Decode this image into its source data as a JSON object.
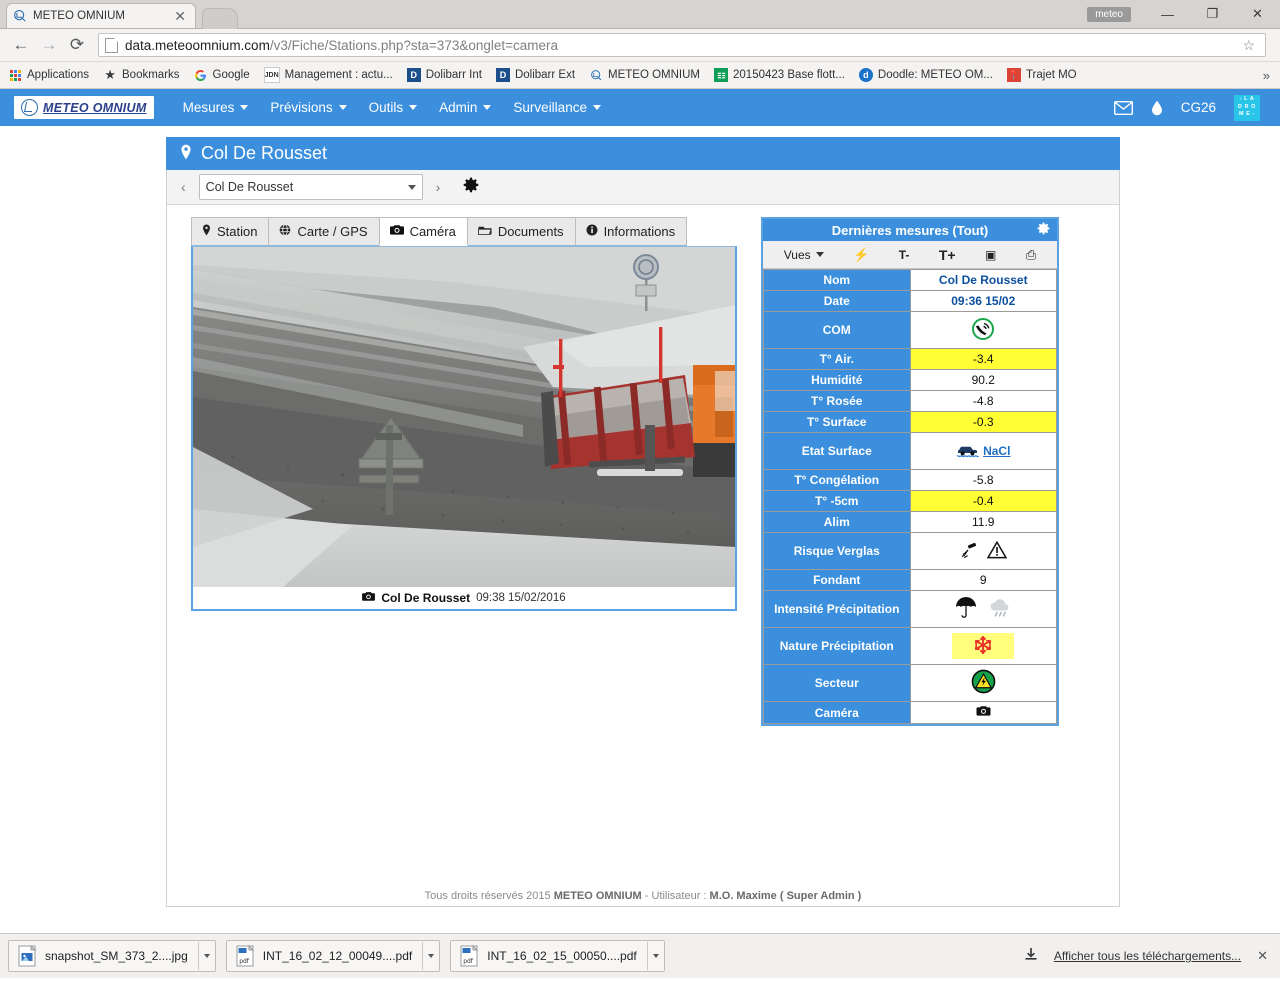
{
  "browser": {
    "tab_title": "METEO OMNIUM",
    "tab_close": "✕",
    "url_main": "data.meteoomnium.com",
    "url_rest": "/v3/Fiche/Stations.php?sta=373&onglet=camera",
    "back_icon": "←",
    "forward_icon": "→",
    "reload_icon": "⟳",
    "star_icon": "☆",
    "window_title_pill": "meteo",
    "minimize": "—",
    "maximize": "❐",
    "close": "✕",
    "bookmarks": [
      {
        "label": "Applications",
        "icon": "apps-grid-icon"
      },
      {
        "label": "Bookmarks",
        "icon": "star-icon"
      },
      {
        "label": "Google",
        "icon": "google-icon"
      },
      {
        "label": "Management : actu...",
        "icon": "jdn-icon"
      },
      {
        "label": "Dolibarr Int",
        "icon": "dolibarr-icon"
      },
      {
        "label": "Dolibarr Ext",
        "icon": "dolibarr-icon"
      },
      {
        "label": "METEO OMNIUM",
        "icon": "meteo-icon"
      },
      {
        "label": "20150423 Base flott...",
        "icon": "sheets-icon"
      },
      {
        "label": "Doodle: METEO OM...",
        "icon": "doodle-icon"
      },
      {
        "label": "Trajet MO",
        "icon": "maps-pin-icon"
      }
    ],
    "bookmarks_overflow": "»"
  },
  "appbar": {
    "brand": "METEO OMNIUM",
    "menu": [
      {
        "label": "Mesures",
        "caret": true
      },
      {
        "label": "Prévisions",
        "caret": true
      },
      {
        "label": "Outils",
        "caret": true
      },
      {
        "label": "Admin",
        "caret": true
      },
      {
        "label": "Surveillance",
        "caret": true
      }
    ],
    "mail_icon": "envelope-icon",
    "drop_icon": "water-drop-icon",
    "user": "CG26",
    "drome_logo_lines": [
      "- L A",
      "D R O",
      "M E -"
    ],
    "accent_color": "#3b8fdd"
  },
  "panel": {
    "title": "Col De Rousset",
    "pin_icon": "map-pin-icon",
    "prev": "‹",
    "next": "›",
    "station_selected": "Col De Rousset",
    "settings_icon": "gear-icon"
  },
  "tabs": [
    {
      "label": "Station",
      "icon": "pin-icon",
      "active": false
    },
    {
      "label": "Carte / GPS",
      "icon": "globe-icon",
      "active": false
    },
    {
      "label": "Caméra",
      "icon": "camera-icon",
      "active": true
    },
    {
      "label": "Documents",
      "icon": "folder-icon",
      "active": false
    },
    {
      "label": "Informations",
      "icon": "info-icon",
      "active": false
    }
  ],
  "camera": {
    "caption_name": "Col De Rousset",
    "caption_time": "09:38 15/02/2016",
    "caption_icon": "camera-icon",
    "scene": "snowy-mountain-road-with-snowplow"
  },
  "measures": {
    "title": "Dernières mesures (Tout)",
    "gear_icon": "gear-icon",
    "toolbar": [
      {
        "label": "Vues",
        "name": "views-dropdown",
        "caret": true
      },
      {
        "label": "⚡",
        "name": "lightning-icon"
      },
      {
        "label": "T-",
        "name": "font-decrease-icon"
      },
      {
        "label": "T+",
        "name": "font-increase-icon"
      },
      {
        "label": "▣",
        "name": "export-excel-icon"
      },
      {
        "label": "⎙",
        "name": "print-icon"
      }
    ],
    "rows": [
      {
        "label": "Nom",
        "value": "Col De Rousset",
        "bold": true,
        "highlight": false
      },
      {
        "label": "Date",
        "value": "09:36 15/02",
        "bold": true,
        "highlight": false
      },
      {
        "label": "COM",
        "value": "",
        "icon": "phone-signal-ok-icon",
        "highlight": false
      },
      {
        "label": "T° Air.",
        "value": "-3.4",
        "highlight": true
      },
      {
        "label": "Humidité",
        "value": "90.2",
        "highlight": false
      },
      {
        "label": "T° Rosée",
        "value": "-4.8",
        "highlight": false
      },
      {
        "label": "T° Surface",
        "value": "-0.3",
        "highlight": true
      },
      {
        "label": "Etat Surface",
        "value": "NaCl",
        "icon": "car-wet-road-icon",
        "highlight": false
      },
      {
        "label": "T° Congélation",
        "value": "-5.8",
        "highlight": false
      },
      {
        "label": "T° -5cm",
        "value": "-0.4",
        "highlight": true
      },
      {
        "label": "Alim",
        "value": "11.9",
        "highlight": false
      },
      {
        "label": "Risque Verglas",
        "value": "",
        "icon": "slippery-warning-icon",
        "highlight": false
      },
      {
        "label": "Fondant",
        "value": "9",
        "highlight": false
      },
      {
        "label": "Intensité Précipitation",
        "value": "",
        "icon": "umbrella-rain-icon",
        "highlight": false
      },
      {
        "label": "Nature Précipitation",
        "value": "",
        "icon": "snowflake-icon",
        "highlight": false
      },
      {
        "label": "Secteur",
        "value": "",
        "icon": "warning-green-icon",
        "highlight": false
      },
      {
        "label": "Caméra",
        "value": "",
        "icon": "camera-icon",
        "highlight": false
      }
    ]
  },
  "footer": {
    "text_a": "Tous droits réservés 2015 ",
    "brand": "METEO OMNIUM",
    "text_b": " - Utilisateur : ",
    "user": "M.O. Maxime ( Super Admin )"
  },
  "downloads": {
    "items": [
      {
        "name": "snapshot_SM_373_2....jpg",
        "type": "jpg"
      },
      {
        "name": "INT_16_02_12_00049....pdf",
        "type": "pdf"
      },
      {
        "name": "INT_16_02_15_00050....pdf",
        "type": "pdf"
      }
    ],
    "show_all": "Afficher tous les téléchargements...",
    "download_icon": "download-icon",
    "close": "✕"
  }
}
